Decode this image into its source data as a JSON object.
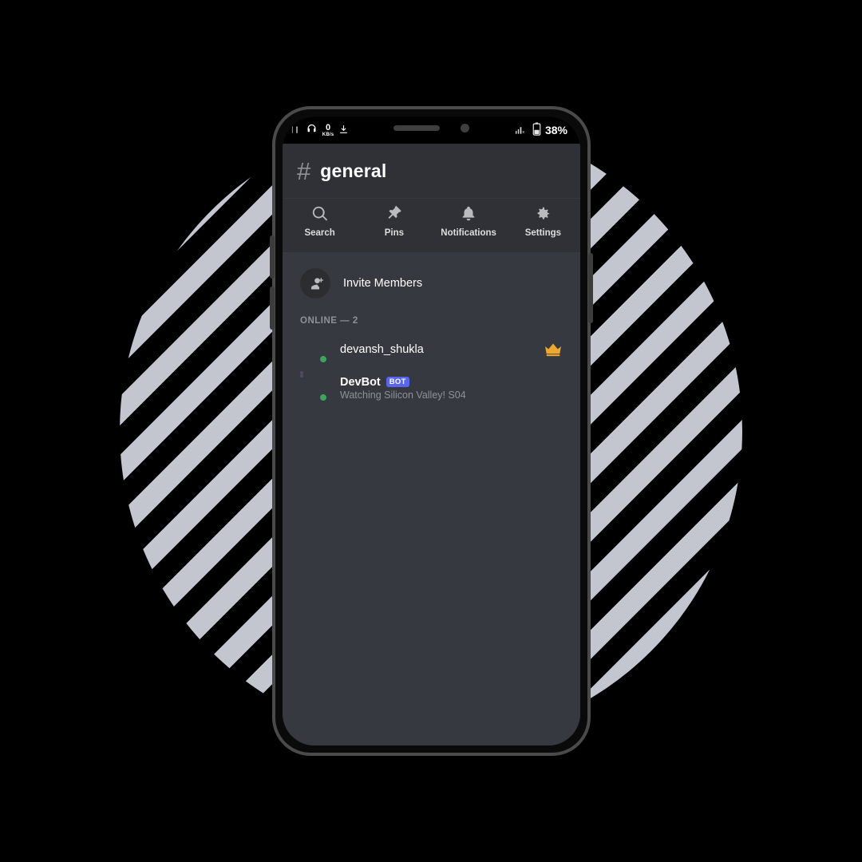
{
  "status_bar": {
    "headphone_icon": "headphone-icon",
    "net_speed_value": "0",
    "net_speed_unit": "KB/s",
    "download_icon": "download-icon",
    "signal_icon": "signal-no-service-icon",
    "battery_icon": "battery-icon",
    "battery_percent": "38%"
  },
  "channel_header": {
    "hash": "#",
    "name": "general"
  },
  "action_tabs": [
    {
      "label": "Search",
      "icon": "search-icon"
    },
    {
      "label": "Pins",
      "icon": "pin-icon"
    },
    {
      "label": "Notifications",
      "icon": "bell-icon"
    },
    {
      "label": "Settings",
      "icon": "gear-icon"
    }
  ],
  "invite": {
    "label": "Invite Members",
    "icon": "person-add-icon"
  },
  "online_section": {
    "header": "ONLINE — 2"
  },
  "members": [
    {
      "name": "devansh_shukla",
      "badge": null,
      "activity": null,
      "presence": "online",
      "owner_icon": "crown-icon",
      "avatar": "user-photo-avatar"
    },
    {
      "name": "DevBot",
      "badge": "BOT",
      "activity": "Watching Silicon Valley! S04",
      "presence": "online",
      "owner_icon": null,
      "avatar": "computer-illustration-avatar"
    }
  ],
  "colors": {
    "brand_blurple": "#5865F2",
    "online_green": "#3BA55C",
    "crown_gold": "#F0A82E",
    "app_background": "#36393F",
    "header_background": "#2F3136",
    "text_primary": "#FFFFFF",
    "text_muted": "#8E9297",
    "backdrop_stripe": "#C3C6CF"
  }
}
